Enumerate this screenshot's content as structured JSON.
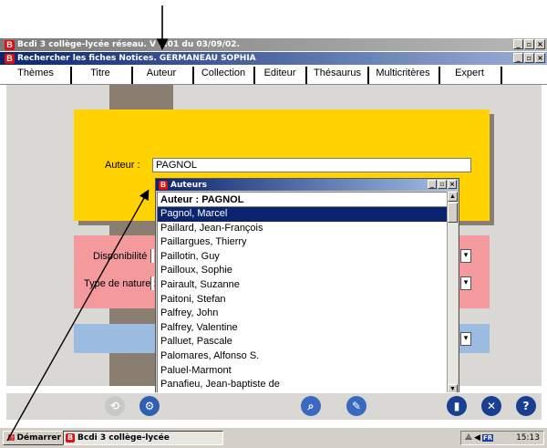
{
  "window": {
    "outer_title": "Bcdi 3 collège-lycée réseau. V 1.01 du 03/09/02.",
    "inner_title": "Rechercher les fiches Notices. GERMANEAU SOPHIA",
    "app_icon_letter": "B",
    "minimize_glyph": "_",
    "restore_glyph": "▫",
    "close_glyph": "×"
  },
  "tabs": [
    "Thèmes",
    "Titre",
    "Auteur",
    "Collection",
    "Editeur",
    "Thésaurus",
    "Multicritères",
    "Expert"
  ],
  "form": {
    "author_label": "Auteur :",
    "author_value": "PAGNOL",
    "disponibilite_label": "Disponibilité :",
    "type_nature_label": "Type de nature :"
  },
  "popup": {
    "title": "Auteurs",
    "header": "Auteur : PAGNOL",
    "items": [
      "Pagnol, Marcel",
      "Paillard, Jean-François",
      "Paillargues, Thierry",
      "Paillotin, Guy",
      "Pailloux, Sophie",
      "Pairault, Suzanne",
      "Paitoni, Stefan",
      "Palfrey, John",
      "Palfrey, Valentine",
      "Palluet, Pascale",
      "Palomares, Alfonso S.",
      "Paluel-Marmont",
      "Panafieu, Jean-baptiste de"
    ],
    "selected_index": 0
  },
  "toolbar": {
    "icons": [
      "back-icon",
      "settings-icon",
      "search-icon",
      "search-clear-icon",
      "info-icon",
      "close-icon",
      "help-icon"
    ],
    "colors": {
      "accent_blue": "#0a2470",
      "panel_yellow": "#ffd200",
      "panel_pink": "#f4999c",
      "panel_blue": "#9bbbe0",
      "column": "#8a7e70"
    }
  },
  "taskbar": {
    "start_label": "Démarrer",
    "task_label": "Bcdi 3 collège-lycée",
    "lang": "FR",
    "clock": "15:13"
  }
}
